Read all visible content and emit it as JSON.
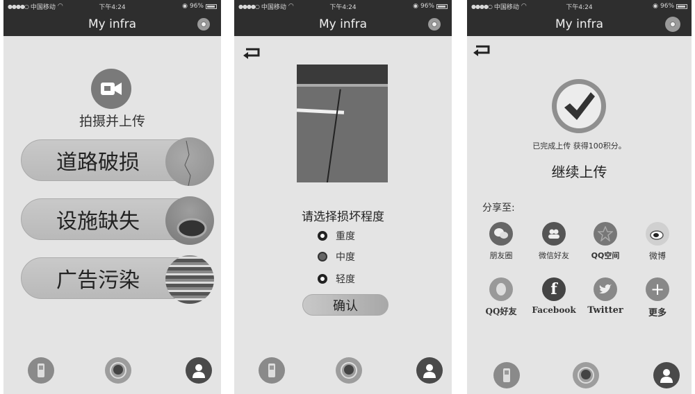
{
  "statusbar": {
    "carrier": "中国移动",
    "time": "下午4:24",
    "battery": "96%"
  },
  "app_title": "My infra",
  "screen1": {
    "capture_label": "拍摄并上传",
    "categories": [
      {
        "label": "道路破损",
        "thumb": "road-crack"
      },
      {
        "label": "设施缺失",
        "thumb": "missing-manhole"
      },
      {
        "label": "广告污染",
        "thumb": "advertising"
      }
    ]
  },
  "screen2": {
    "severity_title": "请选择损坏程度",
    "options": [
      {
        "label": "重度",
        "selected": false
      },
      {
        "label": "中度",
        "selected": true
      },
      {
        "label": "轻度",
        "selected": false
      }
    ],
    "confirm_label": "确认"
  },
  "screen3": {
    "upload_done": "已完成上传  获得100积分。",
    "continue_label": "继续上传",
    "share_label": "分享至:",
    "share_targets": [
      {
        "label": "朋友圈",
        "icon": "wechat-moments-icon"
      },
      {
        "label": "微信好友",
        "icon": "wechat-friends-icon"
      },
      {
        "label": "QQ空间",
        "icon": "qzone-icon"
      },
      {
        "label": "微博",
        "icon": "weibo-icon"
      },
      {
        "label": "QQ好友",
        "icon": "qq-icon"
      },
      {
        "label": "Facebook",
        "icon": "facebook-icon"
      },
      {
        "label": "Twitter",
        "icon": "twitter-icon"
      },
      {
        "label": "更多",
        "icon": "more-icon"
      }
    ]
  },
  "tabbar": {
    "tabs": [
      {
        "icon": "phone-icon"
      },
      {
        "icon": "customer-service-icon"
      },
      {
        "icon": "user-icon"
      }
    ]
  }
}
